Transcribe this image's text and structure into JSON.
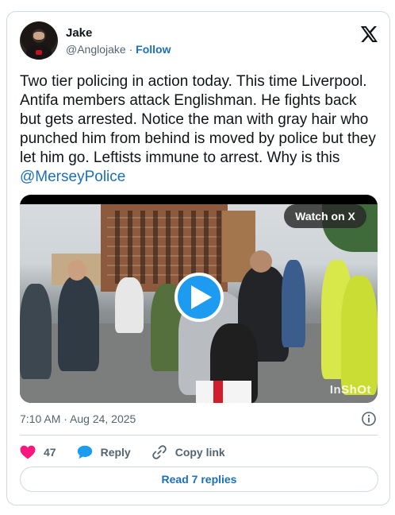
{
  "author": {
    "name": "Jake",
    "handle": "@Anglojake",
    "separator": " · ",
    "follow_label": "Follow"
  },
  "tweet": {
    "text": "Two tier policing in action today. This time Liverpool. Antifa members attack Englishman. He fights back but gets arrested.  Notice the man with gray hair who punched him from behind is moved by police but they let him go. Leftists immune to arrest. Why is this ",
    "mention": "@MerseyPolice"
  },
  "media": {
    "watch_label": "Watch on X",
    "watermark": "InShOt"
  },
  "meta": {
    "timestamp": "7:10 AM · Aug 24, 2025"
  },
  "actions": {
    "like_count": "47",
    "reply_label": "Reply",
    "copy_link_label": "Copy link"
  },
  "read_replies_label": "Read 7 replies",
  "icons": {
    "logo": "x-logo-icon",
    "info": "info-icon",
    "like": "heart-icon",
    "reply": "speech-bubble-icon",
    "copy": "link-icon",
    "play": "play-icon"
  },
  "colors": {
    "accent": "#1d9bf0",
    "link": "#1d6fb8",
    "heart": "#f91880",
    "muted": "#536471",
    "border": "#cfd9de"
  }
}
